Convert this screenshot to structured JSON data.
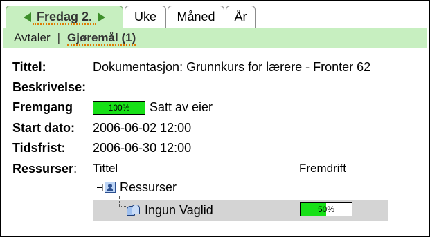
{
  "tabs": {
    "active_label": "Fredag 2.",
    "items": [
      "Uke",
      "Måned",
      "År"
    ]
  },
  "subnav": {
    "link": "Avtaler",
    "separator": "|",
    "current": "Gjøremål (1)"
  },
  "details": {
    "title_label": "Tittel:",
    "title_value": "Dokumentasjon: Grunnkurs for lærere - Fronter 62",
    "description_label": "Beskrivelse:",
    "progress_label": "Fremgang",
    "progress_percent_text": "100%",
    "progress_value": 1.0,
    "progress_status": "Satt av eier",
    "start_label": "Start dato:",
    "start_value": "2006-06-02 12:00",
    "deadline_label": "Tidsfrist:",
    "deadline_value": "2006-06-30 12:00"
  },
  "resources": {
    "label_bold": "Ressurser",
    "label_colon": ":",
    "col_title": "Tittel",
    "col_progress": "Fremdrift",
    "group_name": "Ressurser",
    "person_name": "Ingun Vaglid",
    "person_progress_text": "50%",
    "person_progress_value": 0.5
  },
  "colors": {
    "tab_green": "#c7efc0",
    "progress_green": "#17e017",
    "accent_orange": "#e07b00"
  }
}
